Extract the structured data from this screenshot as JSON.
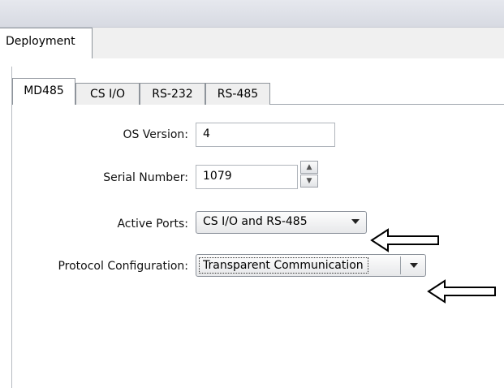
{
  "outer_tab": {
    "label": "Deployment"
  },
  "inner_tabs": [
    {
      "label": "MD485",
      "active": true
    },
    {
      "label": "CS I/O",
      "active": false
    },
    {
      "label": "RS-232",
      "active": false
    },
    {
      "label": "RS-485",
      "active": false
    }
  ],
  "form": {
    "os_version": {
      "label": "OS Version:",
      "value": "4"
    },
    "serial_number": {
      "label": "Serial Number:",
      "value": "1079"
    },
    "active_ports": {
      "label": "Active Ports:",
      "value": "CS I/O and RS-485"
    },
    "protocol_configuration": {
      "label": "Protocol Configuration:",
      "value": "Transparent Communication"
    }
  },
  "annotations": {
    "arrow_icon": "left-arrow-callout-icon"
  }
}
